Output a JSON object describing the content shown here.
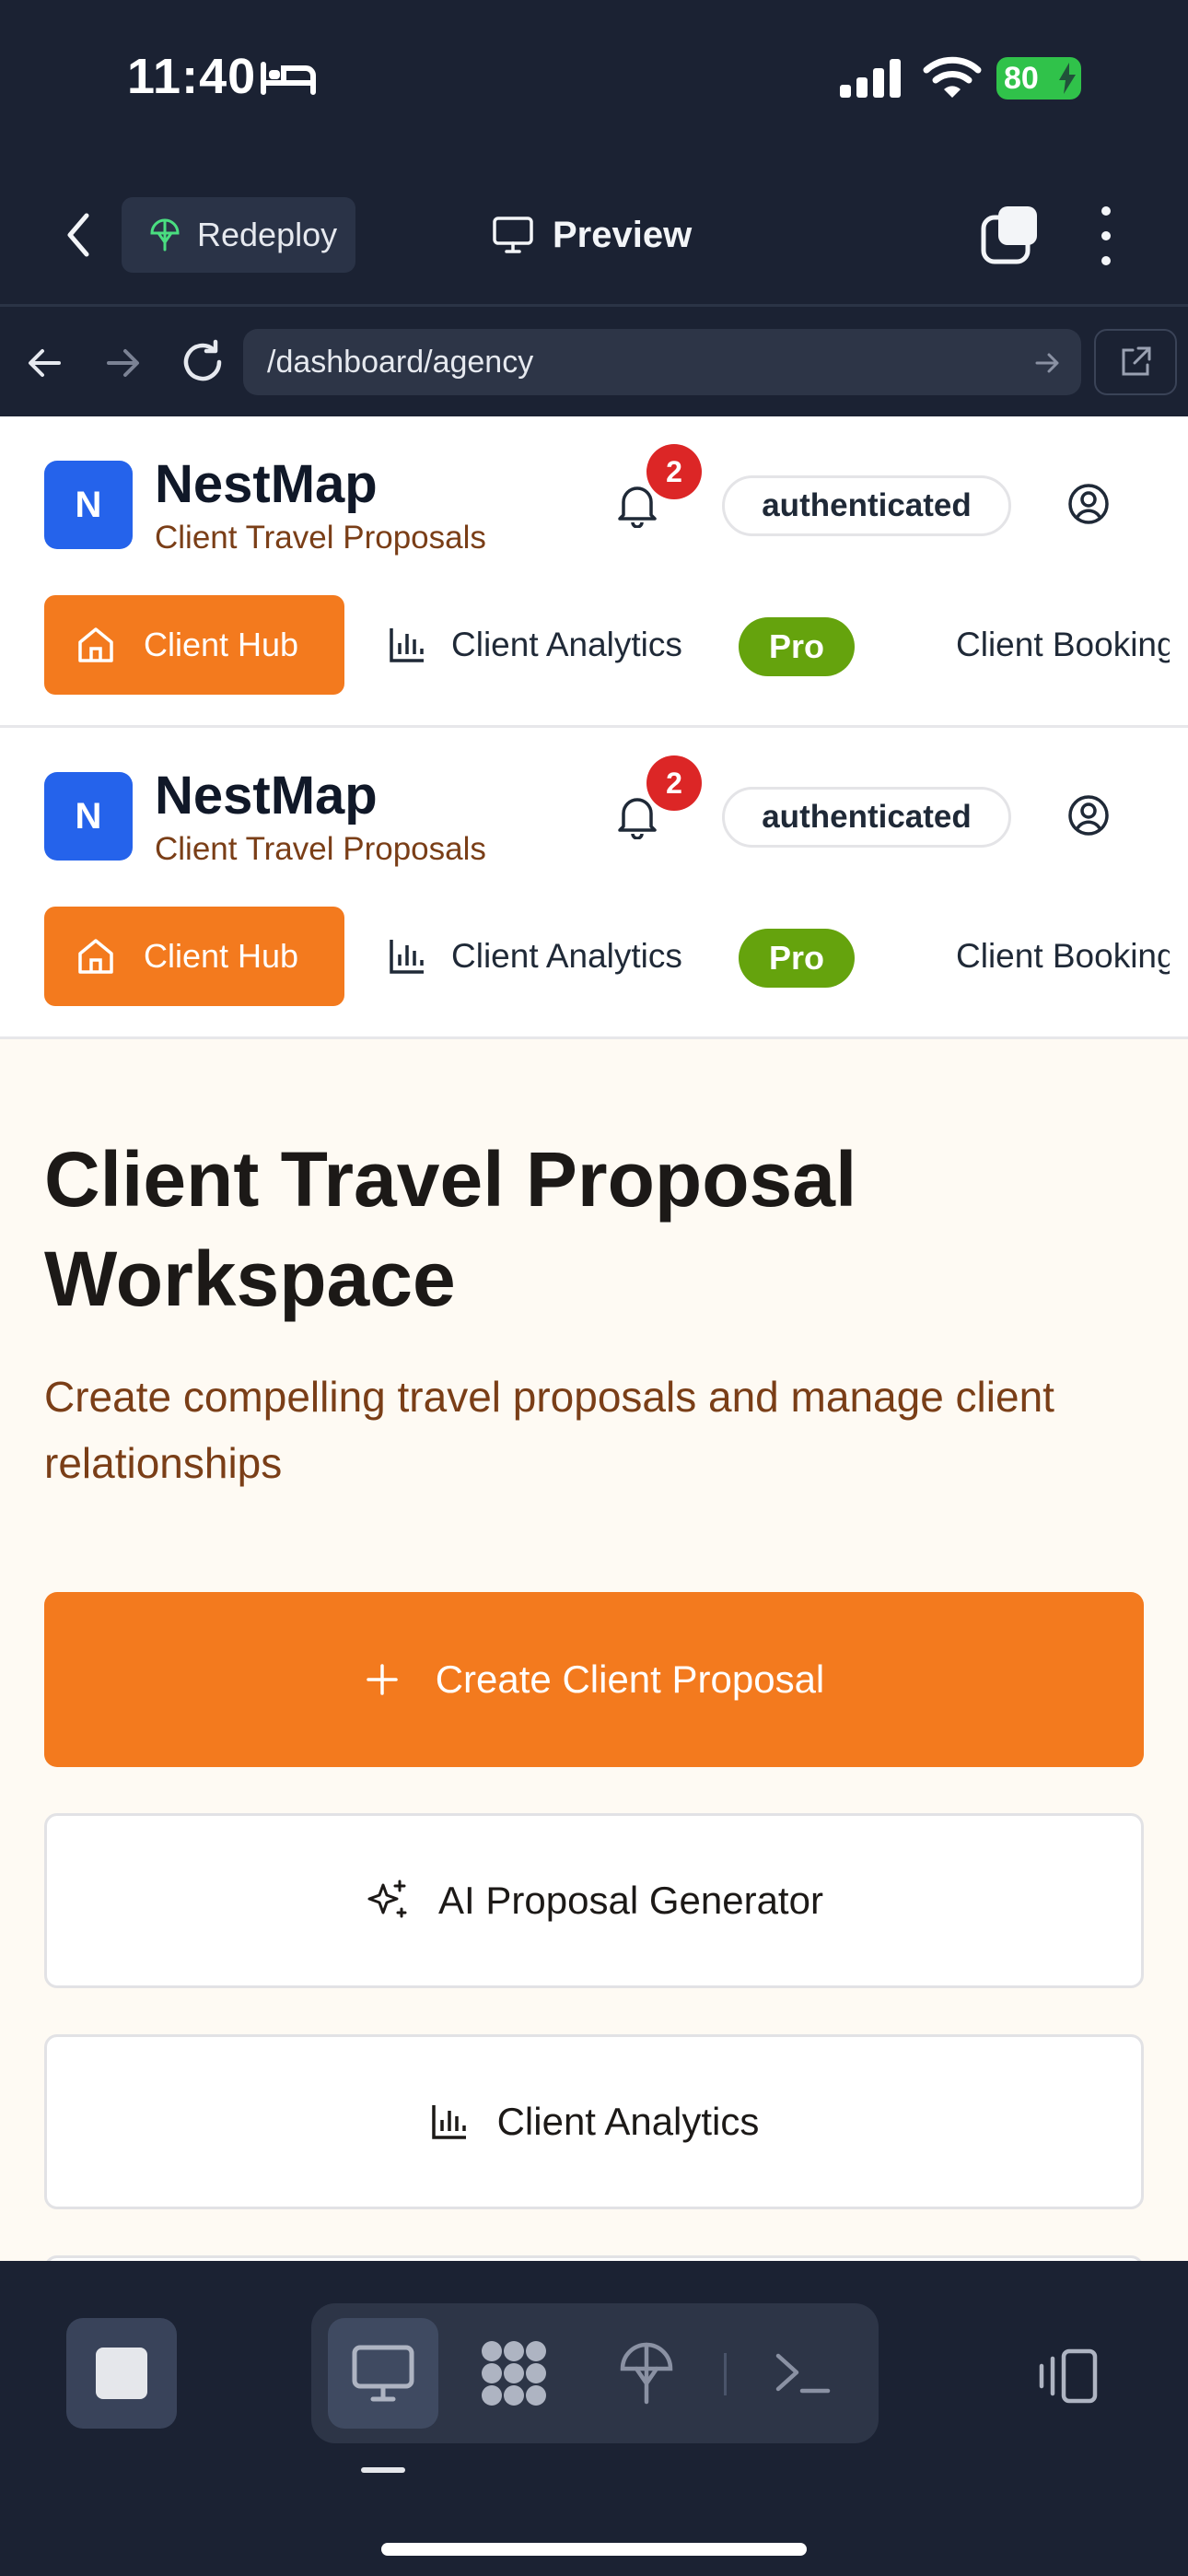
{
  "status_bar": {
    "time": "11:40",
    "battery": "80"
  },
  "app_header": {
    "redeploy_label": "Redeploy",
    "preview_label": "Preview"
  },
  "url_bar": {
    "url": "/dashboard/agency"
  },
  "site_headers": [
    {
      "brand_initial": "N",
      "brand_name": "NestMap",
      "brand_subtitle": "Client Travel Proposals",
      "notification_count": "2",
      "auth_status": "authenticated",
      "nav": {
        "hub": "Client Hub",
        "analytics": "Client Analytics",
        "pro_badge": "Pro",
        "bookings": "Client Bookings"
      }
    },
    {
      "brand_initial": "N",
      "brand_name": "NestMap",
      "brand_subtitle": "Client Travel Proposals",
      "notification_count": "2",
      "auth_status": "authenticated",
      "nav": {
        "hub": "Client Hub",
        "analytics": "Client Analytics",
        "pro_badge": "Pro",
        "bookings": "Client Bookings"
      }
    }
  ],
  "main": {
    "title": "Client Travel Proposal Workspace",
    "description": "Create compelling travel proposals and manage client relationships",
    "buttons": {
      "create": "Create Client Proposal",
      "ai_generator": "AI Proposal Generator",
      "analytics": "Client Analytics"
    }
  },
  "colors": {
    "accent_orange": "#f37a1e",
    "brand_blue": "#2563eb",
    "pro_green": "#65a30d",
    "badge_red": "#dc2626",
    "chrome_dark": "#1b2233"
  },
  "icons": {
    "status": [
      "bed-icon",
      "signal-icon",
      "wifi-icon",
      "battery-icon"
    ],
    "header": [
      "back-icon",
      "redeploy-icon",
      "monitor-icon",
      "tabs-icon",
      "more-icon"
    ],
    "toolbar": [
      "stop-icon",
      "desktop-icon",
      "nodes-icon",
      "deploy-icon",
      "terminal-icon",
      "devices-icon"
    ]
  }
}
